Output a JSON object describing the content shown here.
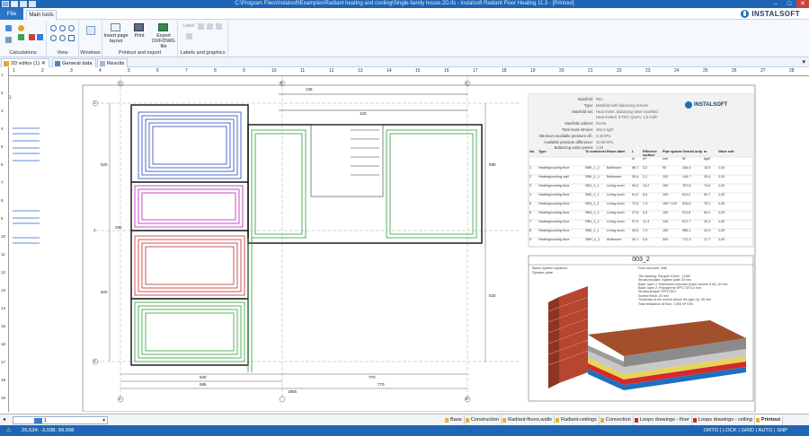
{
  "window": {
    "title": "C:\\Program Files\\Instalsoft\\Examples\\Radiant heating and cooling\\Single-family house.2D.ifs - Instalsoft Radiant Floor Heating 11.3 - [Printout]"
  },
  "menu": {
    "file_label": "File",
    "main_tools_label": "Main tools",
    "logo_text": "INSTALSOFT"
  },
  "ribbon": {
    "groups": [
      {
        "label": "Calculations"
      },
      {
        "label": "View"
      },
      {
        "label": "Windows"
      },
      {
        "label": "Printout and export"
      },
      {
        "label": "Labels and graphics"
      }
    ],
    "insert_page_layout": "Insert page layout",
    "print": "Print",
    "export_dxf": "Export DXF/DWG file",
    "label_btn": "Label"
  },
  "doc_tabs": [
    {
      "label": "2D editor (1)",
      "active": true
    },
    {
      "label": "General data",
      "active": false
    },
    {
      "label": "Results",
      "active": false
    }
  ],
  "ruler": {
    "h_marks": [
      "1",
      "2",
      "3",
      "4",
      "5",
      "6",
      "7",
      "8",
      "9",
      "10",
      "11",
      "12",
      "13",
      "14",
      "15",
      "16",
      "17",
      "18",
      "19",
      "20",
      "21",
      "22",
      "23",
      "24",
      "25",
      "26",
      "27",
      "28"
    ],
    "v_marks": [
      "1",
      "2",
      "3",
      "4",
      "5",
      "6",
      "7",
      "8",
      "9",
      "10",
      "11",
      "12",
      "13",
      "14",
      "15",
      "16",
      "17",
      "18",
      "19"
    ]
  },
  "drawing": {
    "left_label": "DR",
    "dim_bottom_1": "630",
    "dim_bottom_2": "695",
    "dim_bottom_3": "770",
    "dim_bottom_4": "770",
    "dim_bottom_total": "1905",
    "dim_top_1": "135",
    "dim_top_2": "120",
    "dim_left_1": "520",
    "dim_left_2": "520",
    "dim_left_3": "280",
    "dim_right_1": "580",
    "dim_right_2": "520",
    "grid_labels": [
      "A",
      "B",
      "C",
      "D",
      "1",
      "2",
      "3",
      "4"
    ]
  },
  "results_table": {
    "header_lines": [
      {
        "k": "Manifold:",
        "v": "R01"
      },
      {
        "k": "Type:",
        "v": "Manifold with balancing screws"
      },
      {
        "k": "Manifold set:",
        "v": "Heat meter, balancing valve manifold"
      },
      {
        "k": "",
        "v": "Heat meters: 9 FBT, Qnom: 1,5 m3/h"
      },
      {
        "k": "Manifold cabinet:",
        "v": "DAH4"
      },
      {
        "k": "Total mass stream:",
        "v": "462,2 kg/h"
      },
      {
        "k": "Minimum available pressure dif.:",
        "v": "0,40 kPa"
      },
      {
        "k": "Available pressure difference:",
        "v": "10,00 kPa"
      },
      {
        "k": "Balancing valve preset:",
        "v": "1,00"
      }
    ],
    "columns": [
      "No.",
      "Type",
      "To kontrnost",
      "Room label",
      "L",
      "Effective surface",
      "Pipe spacin",
      "Overall outp",
      "m",
      "Valve sett"
    ],
    "units": [
      "",
      "",
      "",
      "",
      "m",
      "m²",
      "mm",
      "W",
      "kg/h",
      ""
    ],
    "rows": [
      [
        "1",
        "Heating/cooling floor",
        "SBK_1_1",
        "Bathroom",
        "56,7",
        "3,2",
        "90",
        "156,4",
        "13,3",
        "1,00"
      ],
      [
        "2",
        "Heating/cooling wall",
        "SBK_1_1",
        "Bathroom",
        "33,4",
        "2,1",
        "100",
        "144,7",
        "25,4",
        "1,00"
      ],
      [
        "3",
        "Heating/cooling floor",
        "SB1_1_1",
        "Living room",
        "94,2",
        "14,2",
        "150",
        "767,8",
        "74,5",
        "1,00"
      ],
      [
        "4",
        "Heating/cooling floor",
        "SB2_1_1",
        "Living room",
        "61,2",
        "8,4",
        "100",
        "611,2",
        "94,7",
        "1,00"
      ],
      [
        "5",
        "Heating/cooling floor",
        "SB3_1_1",
        "Living room",
        "72,5",
        "7,3",
        "150 / 100",
        "516,6",
        "75,1",
        "1,00"
      ],
      [
        "6",
        "Heating/cooling floor",
        "SB4_1_1",
        "Living room",
        "27,6",
        "9,3",
        "150",
        "511,8",
        "54,2",
        "1,00"
      ],
      [
        "7",
        "Heating/cooling floor",
        "RB1_1_1",
        "Living room",
        "97,9",
        "11,3",
        "140",
        "517,7",
        "20,3",
        "1,00"
      ],
      [
        "8",
        "Heating/cooling floor",
        "SB5_1_1",
        "Living room",
        "40,6",
        "7,9",
        "150",
        "355,1",
        "41,9",
        "1,00"
      ],
      [
        "9",
        "Heating/cooling floor",
        "SBH_1_1",
        "Anteroom",
        "20,1",
        "3,6",
        "300",
        "171,3",
        "17,7",
        "1,00"
      ]
    ]
  },
  "detail": {
    "title": "003_2",
    "left_text_1": "Basic system systems",
    "left_text_2": "System plate",
    "right_lines": [
      "Floor structure: Wall",
      "",
      "Tile cladding: Parquet 10mm - 12/80",
      "Structural plate: System plate 30 mm",
      "Base: layer 1: Reinforced concrete (lean) cement 6 kN, 20 mm",
      "Base: layer 2: Polystyrene EPS T30 5,0 mm",
      "Structural layer: EPS DEO",
      "Screed finish: 25 mm",
      "Thickness of the screed above the pipe (h): 45 mm",
      "Total resistance of floor: 1,905 m² K/W"
    ]
  },
  "sheets": [
    {
      "label": "Base",
      "red": false
    },
    {
      "label": "Construction",
      "red": false
    },
    {
      "label": "Radiant-floors,walls",
      "red": false
    },
    {
      "label": "Radiant-ceilings",
      "red": false
    },
    {
      "label": "Convection",
      "red": false
    },
    {
      "label": "Loops drawings - floor",
      "red": true
    },
    {
      "label": "Loops drawings - ceiling",
      "red": true
    },
    {
      "label": "Printout",
      "red": false,
      "active": true
    }
  ],
  "layer_select": {
    "value": "1"
  },
  "status": {
    "coords": "26,534; -3,038; 99,998",
    "modes": "ORTO | LOCK | GRID | AUTO | SNP"
  }
}
